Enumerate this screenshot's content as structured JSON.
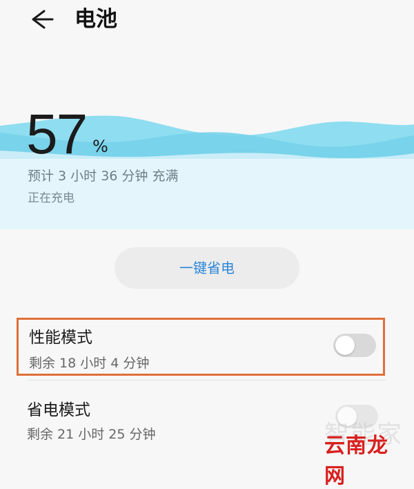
{
  "header": {
    "title": "电池",
    "back_icon": "arrow-left-icon"
  },
  "battery": {
    "percent": "57",
    "unit": "%",
    "estimate": "预计 3 小时 36 分钟 充满",
    "status": "正在充电",
    "wave_color": "#7fd6ec"
  },
  "actions": {
    "one_key_save_label": "一键省电"
  },
  "modes": [
    {
      "title": "性能模式",
      "subtitle": "剩余 18 小时 4 分钟",
      "enabled": false
    },
    {
      "title": "省电模式",
      "subtitle": "剩余 21 小时 25 分钟",
      "enabled": false
    }
  ],
  "watermark": {
    "faded_text": "智能家",
    "site_text": "云南龙网"
  },
  "colors": {
    "accent": "#2b86d9",
    "highlight": "#e06f39",
    "background": "#f7f7f7",
    "watermark_red": "#d8201f"
  }
}
